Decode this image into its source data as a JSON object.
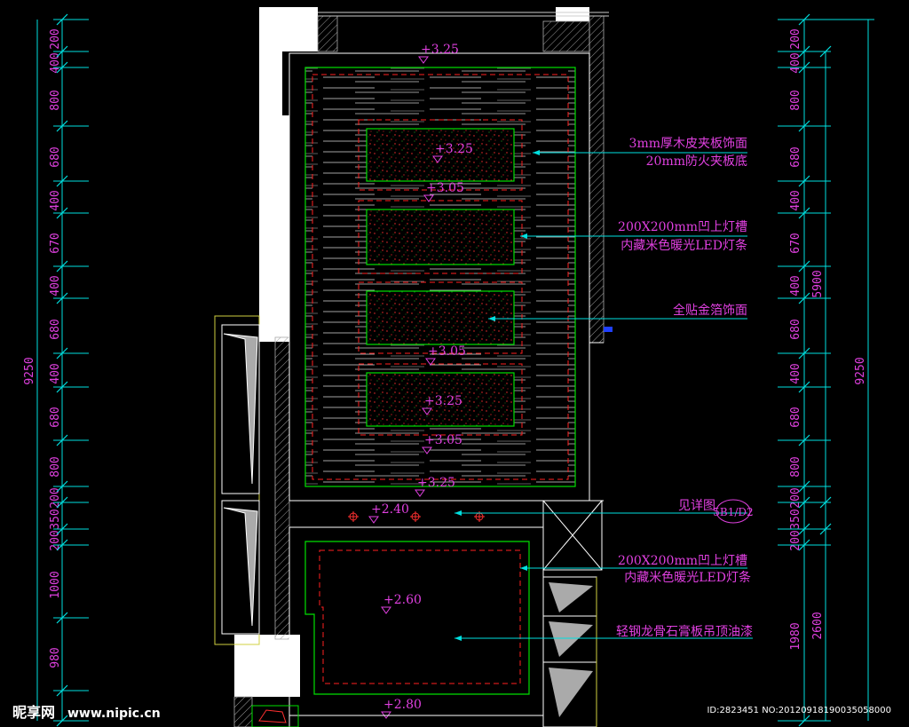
{
  "dimensions_left": [
    "200",
    "400",
    "800",
    "680",
    "400",
    "670",
    "400",
    "680",
    "400",
    "680",
    "800",
    "200",
    "350",
    "200",
    "1000",
    "980"
  ],
  "dimension_left_total": "9250",
  "dimensions_right": [
    "200",
    "400",
    "800",
    "680",
    "400",
    "670",
    "400",
    "680",
    "400",
    "680",
    "800",
    "200",
    "350",
    "200",
    "1980"
  ],
  "dimension_right_mid": "5900",
  "dimension_right_low": "2600",
  "dimension_right_total": "9250",
  "levels": {
    "top": "+3.25",
    "panel1": "+3.25",
    "gap1": "+3.05",
    "gap2": "+3.05",
    "panel4": "+3.25",
    "gap3": "+3.05",
    "band_top": "+3.25",
    "band": "+2.40",
    "lower_ceiling": "+2.60",
    "bottom": "+2.80"
  },
  "notes": {
    "wood_l1": "3mm厚木皮夹板饰面",
    "wood_l2": "20mm防火夹板底",
    "led_l1": "200X200mm凹上灯槽",
    "led_l2": "内藏米色暖光LED灯条",
    "gold": "全贴金箔饰面",
    "detail": "见详图",
    "detail_ref": "5B1/D2",
    "led2_l1": "200X200mm凹上灯槽",
    "led2_l2": "内藏米色暖光LED灯条",
    "gypsum": "轻钢龙骨石膏板吊顶油漆"
  },
  "watermark": {
    "brand": "昵享网",
    "url": "www.nipic.cn",
    "id": "ID:2823451 NO:20120918190035058000"
  },
  "colors": {
    "background": "#000000",
    "dimension": "#00e0e0",
    "text": "#e040e0",
    "outline": "#00e000",
    "hidden": "#ff2020",
    "wall": "#ffffff"
  }
}
